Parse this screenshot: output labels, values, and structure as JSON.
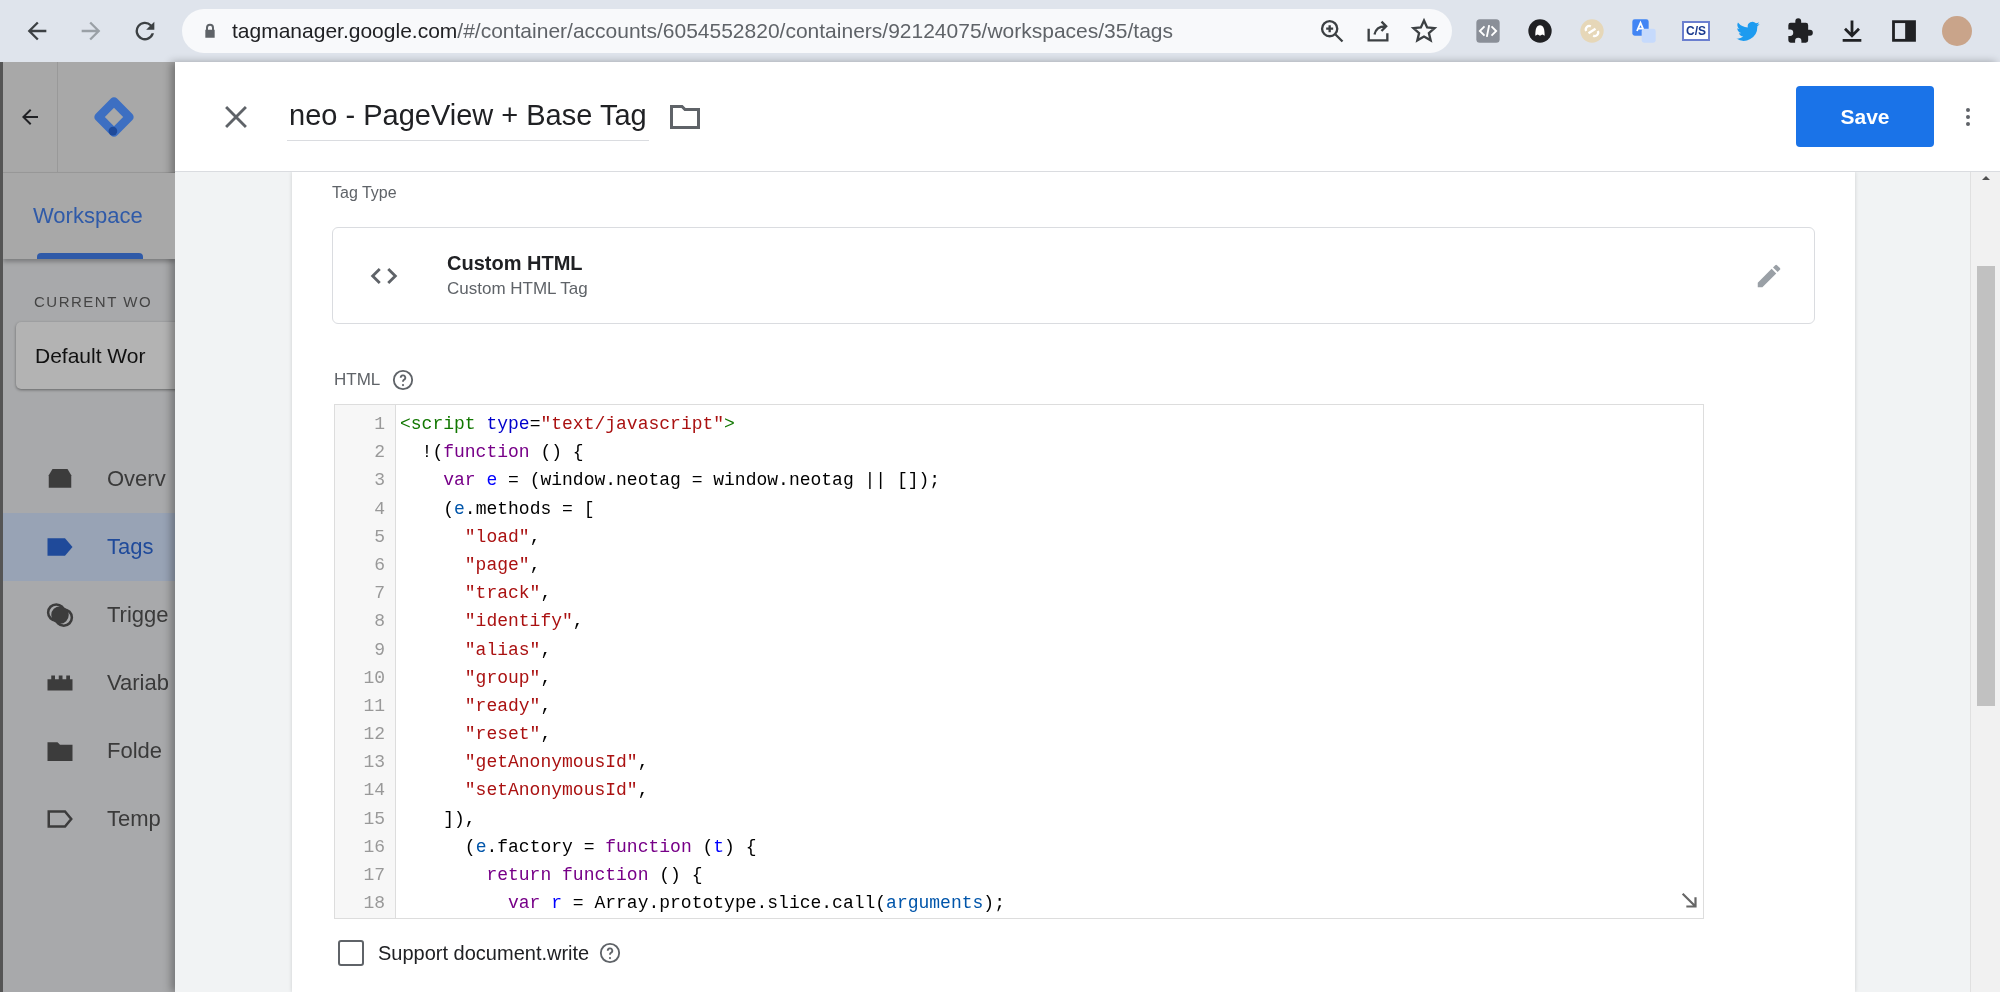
{
  "browser": {
    "nav_buttons": [
      {
        "kind": "back",
        "disabled": false
      },
      {
        "kind": "forward",
        "disabled": true
      },
      {
        "kind": "reload",
        "disabled": false
      }
    ],
    "url_host": "tagmanager.google.com",
    "url_path": "/#/container/accounts/6054552820/containers/92124075/workspaces/35/tags",
    "extension_label": "C/S"
  },
  "sidebar": {
    "tabs": [
      {
        "label": "Workspace",
        "selected": true
      }
    ],
    "section_heading": "CURRENT WO",
    "workspace_button": "Default Wor",
    "items": [
      {
        "label": "Overv",
        "selected": false
      },
      {
        "label": "Tags",
        "selected": true
      },
      {
        "label": "Trigge",
        "selected": false
      },
      {
        "label": "Variab",
        "selected": false
      },
      {
        "label": "Folde",
        "selected": false
      },
      {
        "label": "Temp",
        "selected": false
      }
    ]
  },
  "panel": {
    "title": "neo - PageView + Base Tag",
    "save_button": "Save",
    "tag_type_label": "Tag Type",
    "tag_type": {
      "name": "Custom HTML",
      "description": "Custom HTML Tag"
    },
    "html_label": "HTML",
    "code_lines": [
      {
        "n": "1",
        "tokens": [
          {
            "kind": "tag",
            "text": "<script"
          },
          {
            "kind": "attr",
            "text": " type"
          },
          {
            "kind": "plain",
            "text": "="
          },
          {
            "kind": "string",
            "text": "\"text/javascript\""
          },
          {
            "kind": "tag",
            "text": ">"
          }
        ]
      },
      {
        "n": "2",
        "tokens": [
          {
            "kind": "plain",
            "text": "  !("
          },
          {
            "kind": "keyword",
            "text": "function"
          },
          {
            "kind": "plain",
            "text": " () {"
          }
        ]
      },
      {
        "n": "3",
        "tokens": [
          {
            "kind": "keyword",
            "text": "    var"
          },
          {
            "kind": "def",
            "text": " e"
          },
          {
            "kind": "plain",
            "text": " = (window.neotag = window.neotag || []);"
          }
        ]
      },
      {
        "n": "4",
        "tokens": [
          {
            "kind": "plain",
            "text": "    ("
          },
          {
            "kind": "variable",
            "text": "e"
          },
          {
            "kind": "plain",
            "text": ".methods = ["
          }
        ]
      },
      {
        "n": "5",
        "tokens": [
          {
            "kind": "string",
            "text": "      \"load\""
          },
          {
            "kind": "plain",
            "text": ","
          }
        ]
      },
      {
        "n": "6",
        "tokens": [
          {
            "kind": "string",
            "text": "      \"page\""
          },
          {
            "kind": "plain",
            "text": ","
          }
        ]
      },
      {
        "n": "7",
        "tokens": [
          {
            "kind": "string",
            "text": "      \"track\""
          },
          {
            "kind": "plain",
            "text": ","
          }
        ]
      },
      {
        "n": "8",
        "tokens": [
          {
            "kind": "string",
            "text": "      \"identify\""
          },
          {
            "kind": "plain",
            "text": ","
          }
        ]
      },
      {
        "n": "9",
        "tokens": [
          {
            "kind": "string",
            "text": "      \"alias\""
          },
          {
            "kind": "plain",
            "text": ","
          }
        ]
      },
      {
        "n": "10",
        "tokens": [
          {
            "kind": "string",
            "text": "      \"group\""
          },
          {
            "kind": "plain",
            "text": ","
          }
        ]
      },
      {
        "n": "11",
        "tokens": [
          {
            "kind": "string",
            "text": "      \"ready\""
          },
          {
            "kind": "plain",
            "text": ","
          }
        ]
      },
      {
        "n": "12",
        "tokens": [
          {
            "kind": "string",
            "text": "      \"reset\""
          },
          {
            "kind": "plain",
            "text": ","
          }
        ]
      },
      {
        "n": "13",
        "tokens": [
          {
            "kind": "string",
            "text": "      \"getAnonymousId\""
          },
          {
            "kind": "plain",
            "text": ","
          }
        ]
      },
      {
        "n": "14",
        "tokens": [
          {
            "kind": "string",
            "text": "      \"setAnonymousId\""
          },
          {
            "kind": "plain",
            "text": ","
          }
        ]
      },
      {
        "n": "15",
        "tokens": [
          {
            "kind": "plain",
            "text": "    ]),"
          }
        ]
      },
      {
        "n": "16",
        "tokens": [
          {
            "kind": "plain",
            "text": "      ("
          },
          {
            "kind": "variable",
            "text": "e"
          },
          {
            "kind": "plain",
            "text": ".factory = "
          },
          {
            "kind": "keyword",
            "text": "function"
          },
          {
            "kind": "plain",
            "text": " ("
          },
          {
            "kind": "def",
            "text": "t"
          },
          {
            "kind": "plain",
            "text": ") {"
          }
        ]
      },
      {
        "n": "17",
        "tokens": [
          {
            "kind": "keyword",
            "text": "        return"
          },
          {
            "kind": "keyword",
            "text": " function"
          },
          {
            "kind": "plain",
            "text": " () {"
          }
        ]
      },
      {
        "n": "18",
        "tokens": [
          {
            "kind": "keyword",
            "text": "          var"
          },
          {
            "kind": "def",
            "text": " r"
          },
          {
            "kind": "plain",
            "text": " = Array.prototype.slice.call("
          },
          {
            "kind": "variable",
            "text": "arguments"
          },
          {
            "kind": "plain",
            "text": ");"
          }
        ]
      }
    ],
    "support_document_write": {
      "label": "Support document.write",
      "checked": false
    }
  }
}
